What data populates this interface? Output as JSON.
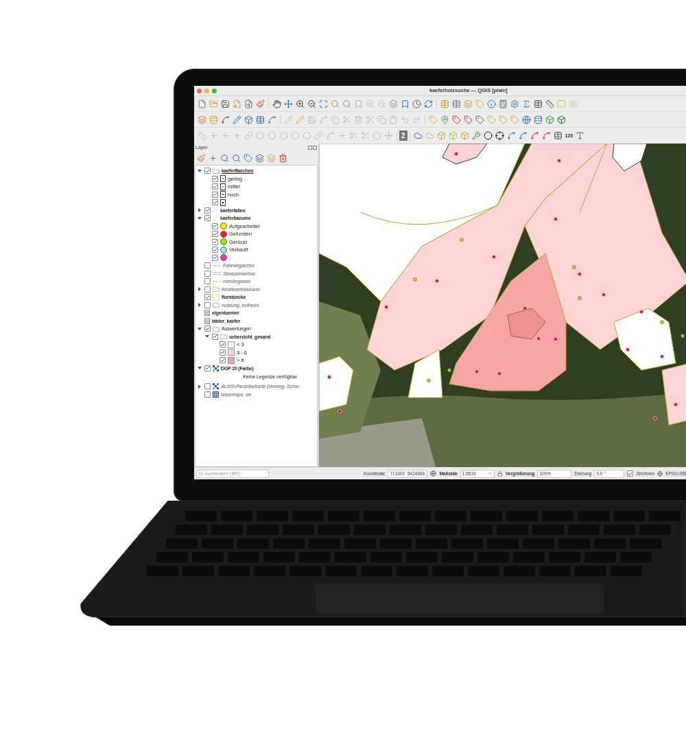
{
  "window": {
    "title": "kaeferholzsuche — QGIS [plain]"
  },
  "toolbar_texts": {
    "number_button": "2",
    "label_tool": "123"
  },
  "layers_panel": {
    "title": "Layer",
    "items": [
      {
        "label": "kaeferflaechen",
        "kind": "group",
        "checked": true,
        "expanded": true,
        "selected": true,
        "bold": true,
        "dimmed": false,
        "children": [
          {
            "label": "gering",
            "kind": "legend-marker",
            "checked": true,
            "color": "#33cc33"
          },
          {
            "label": "mittel",
            "kind": "legend-marker",
            "checked": true,
            "color": "#ee6666"
          },
          {
            "label": "hoch",
            "kind": "legend-marker",
            "checked": true,
            "color": "#dd1111"
          },
          {
            "kind": "legend-marker",
            "checked": true,
            "color": "#111111"
          }
        ]
      },
      {
        "label": "kaeferfallen",
        "kind": "points",
        "checked": true,
        "expanded": false,
        "selected": false,
        "bold": true,
        "dimmed": false
      },
      {
        "label": "kaeferbaeume",
        "kind": "points",
        "checked": true,
        "expanded": true,
        "selected": false,
        "bold": true,
        "dimmed": false,
        "children": [
          {
            "label": "Aufgearbeitet",
            "kind": "legend-circle",
            "checked": true,
            "color": "#ffee00"
          },
          {
            "label": "Gefunden",
            "kind": "legend-circle",
            "checked": true,
            "color": "#ee1133"
          },
          {
            "label": "Gerückt",
            "kind": "legend-circle",
            "checked": true,
            "color": "#88ee00"
          },
          {
            "label": "Verkauft",
            "kind": "legend-circle",
            "checked": true,
            "color": "#77eeee"
          },
          {
            "kind": "legend-circle",
            "checked": true,
            "color": "#ee33bb"
          }
        ]
      },
      {
        "label": "Fahrwegachse",
        "kind": "line",
        "checked": false,
        "selected": false,
        "bold": true,
        "dimmed": true
      },
      {
        "label": "Strassenachse",
        "kind": "double-line",
        "checked": false,
        "selected": false,
        "bold": true,
        "dimmed": true
      },
      {
        "label": "rueckegasse",
        "kind": "dashed-line",
        "checked": false,
        "selected": false,
        "bold": true,
        "dimmed": true
      },
      {
        "label": "forstbetriebskarte",
        "kind": "group",
        "checked": false,
        "expanded": false,
        "selected": false,
        "bold": true,
        "dimmed": true
      },
      {
        "label": "flurstuecke",
        "kind": "polygon",
        "color": "#f5e88a",
        "checked": true,
        "selected": false,
        "bold": true,
        "dimmed": false
      },
      {
        "label": "nutzung_kelheim",
        "kind": "group",
        "checked": false,
        "expanded": false,
        "selected": false,
        "bold": true,
        "dimmed": true
      },
      {
        "label": "eigentuemer",
        "kind": "table",
        "selected": false,
        "bold": true,
        "dimmed": false
      },
      {
        "label": "bilder_kaefer",
        "kind": "table",
        "selected": false,
        "bold": true,
        "dimmed": false
      },
      {
        "label": "Auswertungen",
        "kind": "group",
        "checked": true,
        "expanded": true,
        "selected": false,
        "bold": false,
        "dimmed": false,
        "children": [
          {
            "label": "uebersicht_gesamt",
            "kind": "group",
            "checked": true,
            "expanded": true,
            "selected": false,
            "bold": true,
            "dimmed": false,
            "children": [
              {
                "label": "< 3",
                "kind": "legend-fill",
                "checked": true,
                "color": "#ffffff"
              },
              {
                "label": "3 - 6",
                "kind": "legend-fill",
                "checked": true,
                "color": "#ffd4d4"
              },
              {
                "label": "> 6",
                "kind": "legend-fill",
                "checked": true,
                "color": "#f7a1a1"
              }
            ]
          }
        ]
      },
      {
        "label": "DOP 20 (Farbe)",
        "kind": "raster",
        "checked": true,
        "expanded": true,
        "selected": false,
        "bold": true,
        "dimmed": false,
        "children": [
          {
            "label": "Keine Legende verfügbar",
            "kind": "note"
          }
        ]
      },
      {
        "label": "ALKIS-Parzellarkarte (Umring, Schw",
        "kind": "raster",
        "checked": false,
        "expanded": false,
        "selected": false,
        "bold": true,
        "dimmed": true
      },
      {
        "label": "basemaps_de",
        "kind": "grid",
        "checked": false,
        "selected": false,
        "bold": true,
        "dimmed": true
      }
    ]
  },
  "status_bar": {
    "search": {
      "placeholder": "Suchmuster (⌘K)"
    },
    "coordinate": {
      "label": "Koordinate",
      "value": "713300  5424666"
    },
    "scale": {
      "label": "Maßstab",
      "value": "1:6516"
    },
    "magnifier": {
      "label": "Vergrößerung",
      "value": "100%"
    },
    "rotation": {
      "label": "Drehung",
      "value": "0,0 °"
    },
    "render": {
      "label": "Zeichnen",
      "checked": true
    },
    "crs": "EPSG:258"
  }
}
